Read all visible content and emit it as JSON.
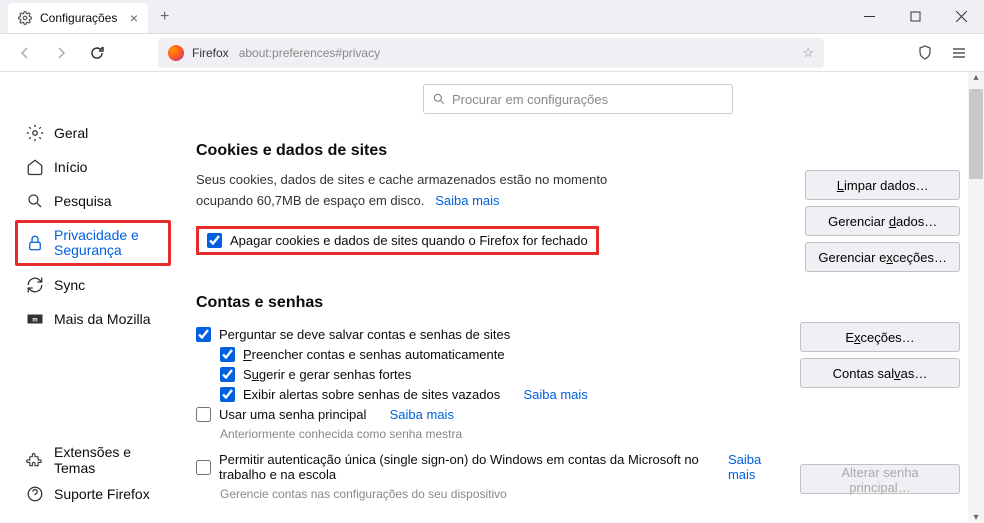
{
  "tab": {
    "title": "Configurações"
  },
  "url": {
    "prefix": "Firefox",
    "path": "about:preferences#privacy"
  },
  "search": {
    "placeholder": "Procurar em configurações"
  },
  "sidebar": {
    "general": "Geral",
    "home": "Início",
    "search": "Pesquisa",
    "privacy": "Privacidade e Segurança",
    "sync": "Sync",
    "more": "Mais da Mozilla",
    "extensions": "Extensões e Temas",
    "support": "Suporte Firefox"
  },
  "cookies": {
    "heading": "Cookies e dados de sites",
    "desc1": "Seus cookies, dados de sites e cache armazenados estão no momento ocupando 60,7MB de espaço em disco.",
    "learn": "Saiba mais",
    "clear_checkbox": "Apagar cookies e dados de sites quando o Firefox for fechado",
    "btn_clear": "Limpar dados…",
    "btn_manage": "Gerenciar dados…",
    "btn_exceptions": "Gerenciar exceções…"
  },
  "logins": {
    "heading": "Contas e senhas",
    "ask_save": "Perguntar se deve salvar contas e senhas de sites",
    "autofill": "Preencher contas e senhas automaticamente",
    "suggest": "Sugerir e gerar senhas fortes",
    "alerts": "Exibir alertas sobre senhas de sites vazados",
    "learn": "Saiba mais",
    "master": "Usar uma senha principal",
    "master_note": "Anteriormente conhecida como senha mestra",
    "sso": "Permitir autenticação única (single sign-on) do Windows em contas da Microsoft no trabalho e na escola",
    "sso_note": "Gerencie contas nas configurações do seu dispositivo",
    "btn_exceptions": "Exceções…",
    "btn_saved": "Contas salvas…",
    "btn_change_master": "Alterar senha principal…"
  }
}
